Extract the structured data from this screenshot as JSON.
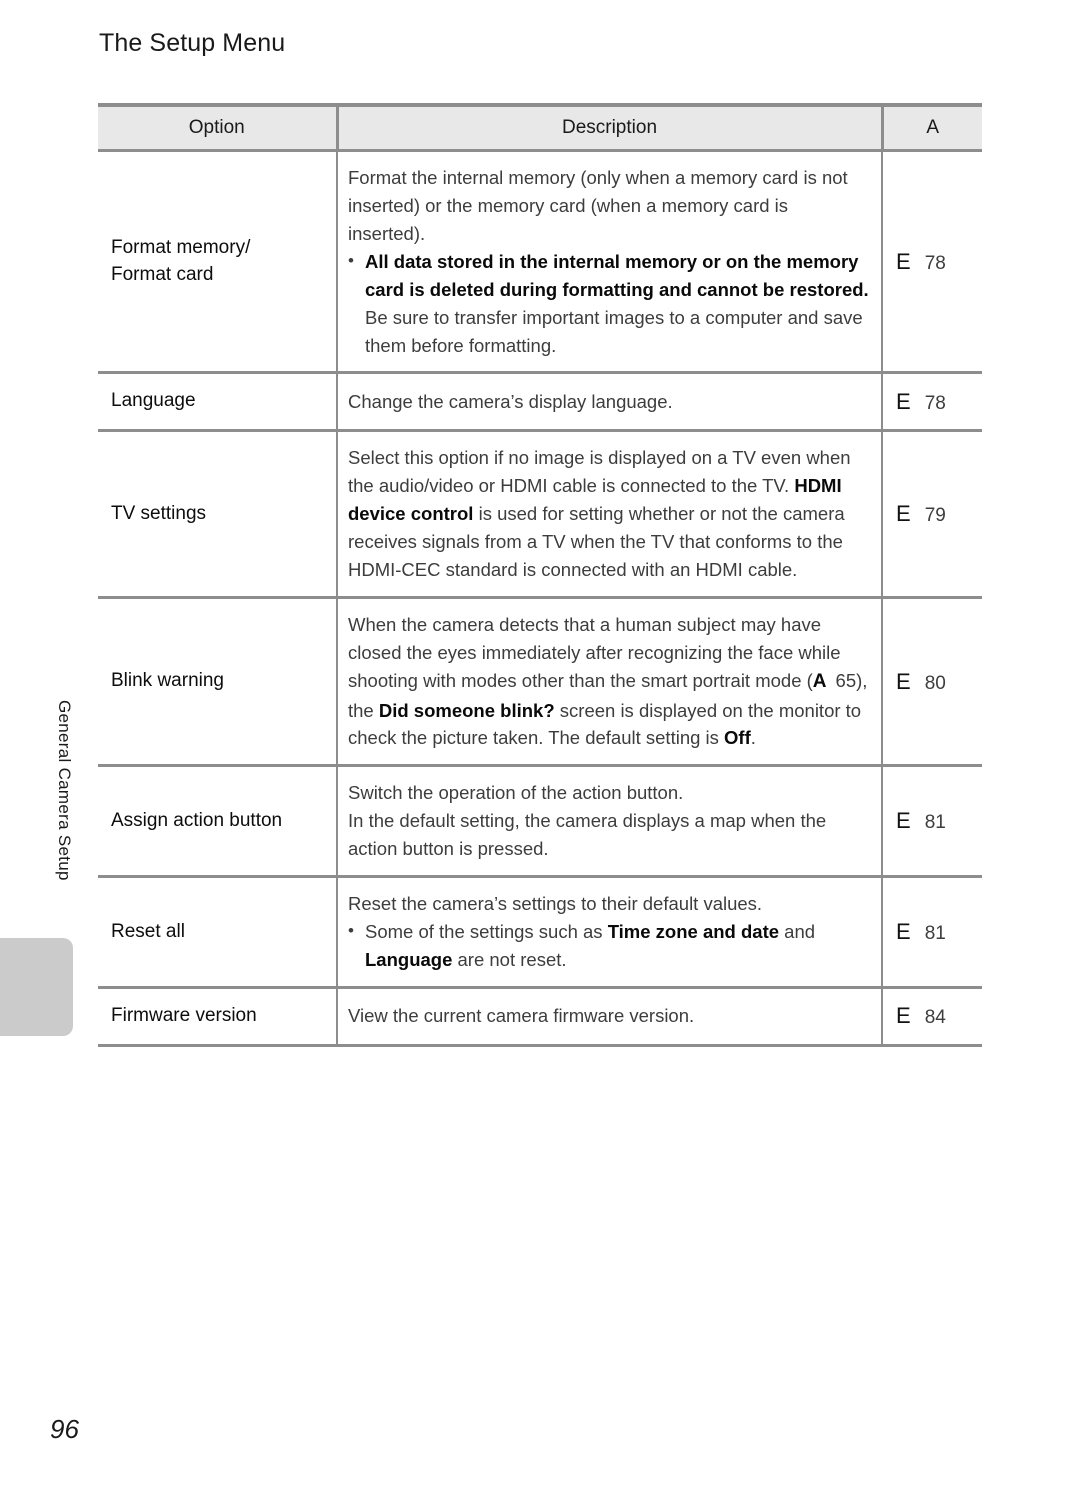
{
  "page": {
    "title": "The Setup Menu",
    "folio": "96",
    "side_tab_label": "General Camera Setup"
  },
  "table": {
    "headers": {
      "option": "Option",
      "description": "Description",
      "reference": "A"
    },
    "rows": [
      {
        "option": "Format memory/\nFormat card",
        "option_line1": "Format memory/",
        "option_line2": "Format card",
        "description_intro": "Format the internal memory (only when a memory card is not inserted) or the memory card (when a memory card is inserted).",
        "bullets": [
          {
            "bold": "All data stored in the internal memory or on the memory card is deleted during formatting and cannot be restored.",
            "rest": " Be sure to transfer important images to a computer and save them before formatting."
          }
        ],
        "ref_symbol": "E",
        "ref_page": "78"
      },
      {
        "option": "Language",
        "description_intro": "Change the camera’s display language.",
        "bullets": [],
        "ref_symbol": "E",
        "ref_page": "78"
      },
      {
        "option": "TV settings",
        "description_intro": "Select this option if no image is displayed on a TV even when the audio/video or HDMI cable is connected to the TV. ",
        "inline_bold": "HDMI device control",
        "description_tail": " is used for setting whether or not the camera receives signals from a TV when the TV that conforms to the HDMI-CEC standard is connected with an HDMI cable.",
        "bullets": [],
        "ref_symbol": "E",
        "ref_page": "79"
      },
      {
        "option": "Blink warning",
        "description_part1": "When the camera detects that a human subject may have closed the eyes immediately after recognizing the face while shooting with modes other than the smart portrait mode (",
        "inline_glyph": "A",
        "description_part2": "65), the ",
        "inline_bold2": "Did someone blink?",
        "description_part3": " screen is displayed on the monitor to check the picture taken. The default setting is ",
        "inline_bold3": "Off",
        "description_part4": ".",
        "bullets": [],
        "ref_symbol": "E",
        "ref_page": "80"
      },
      {
        "option": "Assign action button",
        "description_intro": "Switch the operation of the action button.",
        "description_line2": "In the default setting, the camera displays a map when the action button is pressed.",
        "bullets": [],
        "ref_symbol": "E",
        "ref_page": "81"
      },
      {
        "option": "Reset all",
        "description_intro": "Reset the camera’s settings to their default values.",
        "bullets": [
          {
            "pre": "Some of the settings such as ",
            "bold": "Time zone and date",
            "mid": " and ",
            "bold2": "Language",
            "post": " are not reset."
          }
        ],
        "ref_symbol": "E",
        "ref_page": "81"
      },
      {
        "option": "Firmware version",
        "description_intro": "View the current camera firmware version.",
        "bullets": [],
        "ref_symbol": "E",
        "ref_page": "84"
      }
    ]
  },
  "colors": {
    "border": "#8d8d8d",
    "header_bg": "#e8e8e8",
    "body_text": "#3d3d3d",
    "tab_gray": "#cbcbcb"
  }
}
